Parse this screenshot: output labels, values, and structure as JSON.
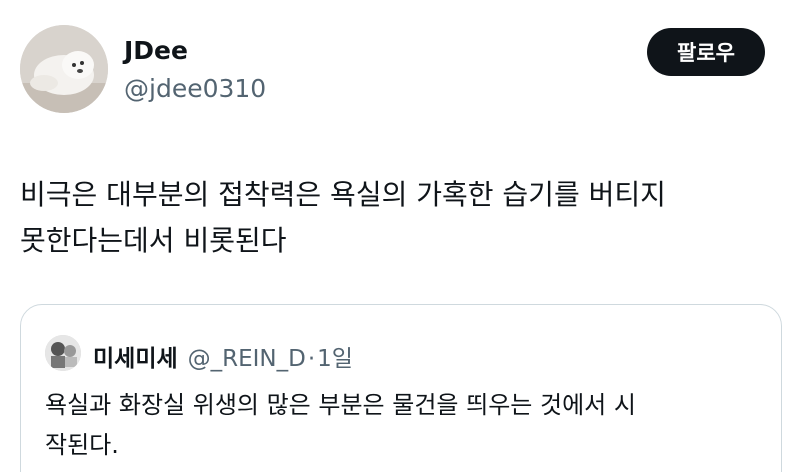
{
  "author": {
    "display_name": "JDee",
    "handle": "@jdee0310",
    "avatar_icon": "avatar-photo-dog"
  },
  "follow_button": {
    "label": "팔로우"
  },
  "tweet": {
    "line1": "비극은 대부분의 접착력은 욕실의 가혹한 습기를 버티지",
    "line2": "못한다는데서 비롯된다"
  },
  "quote": {
    "display_name": "미세미세",
    "handle": "@_REIN_D",
    "separator": "·",
    "time": "1일",
    "line1": "욕실과 화장실 위생의 많은 부분은 물건을 띄우는 것에서 시",
    "line2": "작된다.",
    "avatar_icon": "avatar-illustration"
  },
  "colors": {
    "text_primary": "#0f1419",
    "text_secondary": "#536471",
    "button_bg": "#0f1419",
    "border": "#cfd9de"
  }
}
